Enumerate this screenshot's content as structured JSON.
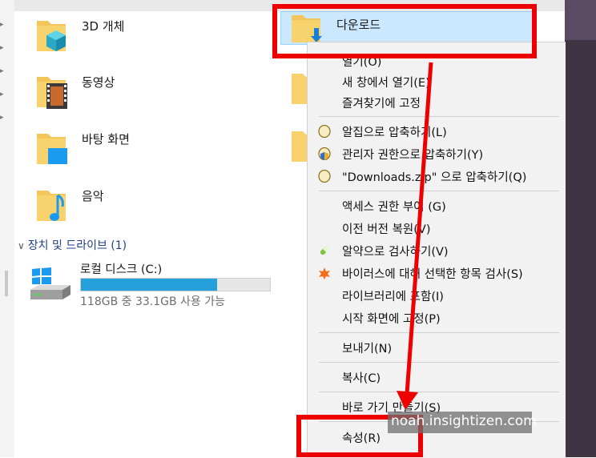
{
  "folders": [
    {
      "label": "3D 개체",
      "icon": "3d-objects-folder-icon"
    },
    {
      "label": "동영상",
      "icon": "videos-folder-icon"
    },
    {
      "label": "바탕 화면",
      "icon": "desktop-folder-icon"
    },
    {
      "label": "음악",
      "icon": "music-folder-icon"
    }
  ],
  "selected_folder": {
    "label": "다운로드",
    "icon": "downloads-folder-icon"
  },
  "devices": {
    "section_label": "장치 및 드라이브 (1)",
    "drive": {
      "name": "로컬 디스크 (C:)",
      "used_fraction": 0.72,
      "free_text": "118GB 중 33.1GB 사용 가능"
    }
  },
  "context_menu": {
    "items": [
      {
        "label": "열기(O)",
        "icon": ""
      },
      {
        "label": "새 창에서 열기(E)",
        "icon": ""
      },
      {
        "label": "즐겨찾기에 고정",
        "icon": ""
      },
      {
        "label": "알집으로 압축하기(L)",
        "icon": "alzip-icon"
      },
      {
        "label": "관리자 권한으로 압축하기(Y)",
        "icon": "shield-alzip-icon"
      },
      {
        "label": "\"Downloads.zip\" 으로 압축하기(Q)",
        "icon": "alzip-icon"
      },
      {
        "label": "액세스 권한 부여 (G)",
        "icon": ""
      },
      {
        "label": "이전 버전 복원(V)",
        "icon": ""
      },
      {
        "label": "알약으로 검사하기(V)",
        "icon": "alyac-icon"
      },
      {
        "label": "바이러스에 대해 선택한 항목 검사(S)",
        "icon": "avast-icon"
      },
      {
        "label": "라이브러리에 포함(I)",
        "icon": ""
      },
      {
        "label": "시작 화면에 고정(P)",
        "icon": ""
      },
      {
        "label": "보내기(N)",
        "icon": ""
      },
      {
        "label": "복사(C)",
        "icon": ""
      },
      {
        "label": "바로 가기 만들기(S)",
        "icon": ""
      },
      {
        "label": "속성(R)",
        "icon": ""
      }
    ]
  },
  "watermark": "noah.insightizen.com",
  "colors": {
    "highlight": "#cce8ff",
    "annotation": "#ef0000",
    "drive_bar": "#26a0da"
  }
}
